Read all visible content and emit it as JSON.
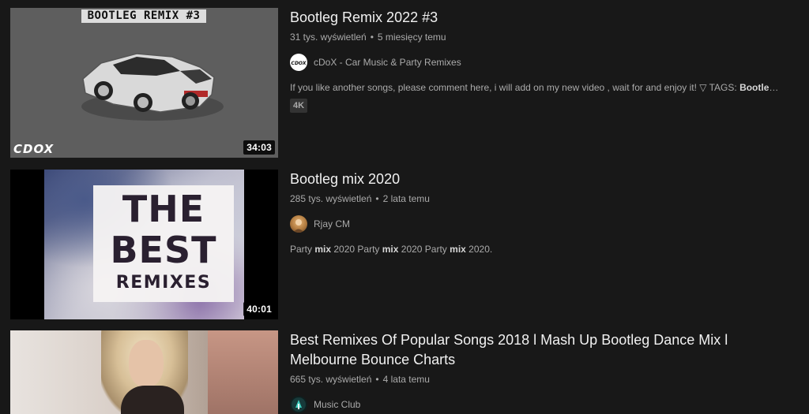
{
  "videos": [
    {
      "title": "Bootleg Remix 2022 #3",
      "views": "31 tys. wyświetleń",
      "age": "5 miesięcy temu",
      "channel": "cDoX - Car Music & Party Remixes",
      "description_parts": [
        {
          "text": "If you like another songs, please comment here, i will add on my new video , wait for and enjoy it! ▽ TAGS: ",
          "bold": false
        },
        {
          "text": "Bootleg Remix",
          "bold": true
        },
        {
          "text": " ...",
          "bold": false
        }
      ],
      "badge": "4K",
      "duration": "34:03",
      "thumb_banner": "BOOTLEG REMIX #3",
      "thumb_logo": "CDOX",
      "avatar_icon": "cdox-logo-icon"
    },
    {
      "title": "Bootleg mix 2020",
      "views": "285 tys. wyświetleń",
      "age": "2 lata temu",
      "channel": "Rjay CM",
      "description_parts": [
        {
          "text": "Party ",
          "bold": false
        },
        {
          "text": "mix",
          "bold": true
        },
        {
          "text": " 2020 Party ",
          "bold": false
        },
        {
          "text": "mix",
          "bold": true
        },
        {
          "text": " 2020 Party ",
          "bold": false
        },
        {
          "text": "mix",
          "bold": true
        },
        {
          "text": " 2020.",
          "bold": false
        }
      ],
      "duration": "40:01",
      "thumb_lines": [
        "THE",
        "BEST",
        "REMIXES"
      ],
      "avatar_icon": "user-avatar-icon"
    },
    {
      "title": "Best Remixes Of Popular Songs 2018 l Mash Up Bootleg Dance Mix l Melbourne Bounce Charts",
      "views": "665 tys. wyświetleń",
      "age": "4 lata temu",
      "channel": "Music Club",
      "avatar_icon": "music-club-icon"
    }
  ],
  "colors": {
    "background": "#181818",
    "title": "#f1f1f1",
    "secondary": "#aaaaaa",
    "badge_bg": "#333333"
  }
}
